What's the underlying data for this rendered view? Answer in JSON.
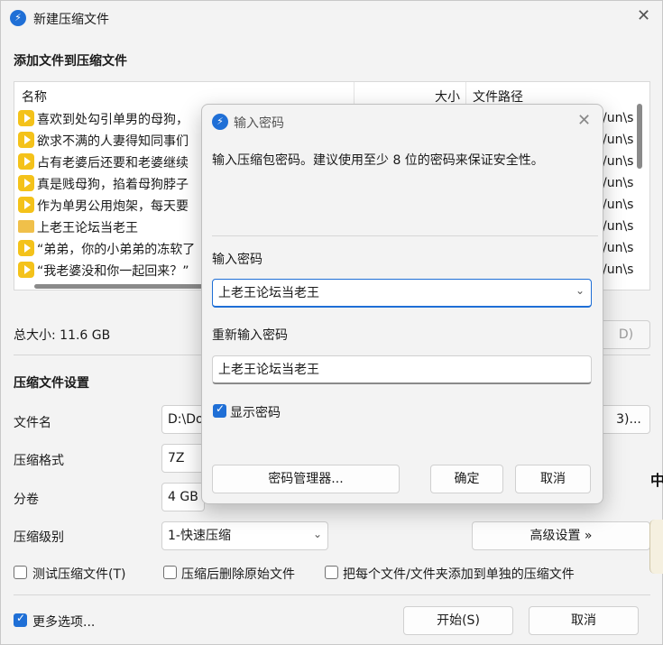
{
  "main": {
    "title": "新建压缩文件",
    "add_files_title": "添加文件到压缩文件",
    "columns": {
      "name": "名称",
      "size": "大小",
      "path": "文件路径"
    },
    "rows": [
      {
        "name": "喜欢到处勾引单男的母狗，",
        "icon": "video-icon",
        "path": "/un\\s"
      },
      {
        "name": "欲求不满的人妻得知同事们",
        "icon": "video-icon",
        "path": "/un\\s"
      },
      {
        "name": "占有老婆后还要和老婆继续",
        "icon": "video-icon",
        "path": "/un\\s"
      },
      {
        "name": "真是贱母狗，掐着母狗脖子",
        "icon": "video-icon",
        "path": "/un\\s"
      },
      {
        "name": "作为单男公用炮架，每天要",
        "icon": "video-icon",
        "path": "/un\\s"
      },
      {
        "name": "上老王论坛当老王",
        "icon": "folder-icon",
        "path": "/un\\s"
      },
      {
        "name": "“弟弟，你的小弟弟的冻软了",
        "icon": "video-icon",
        "path": "/un\\s"
      },
      {
        "name": "“我老婆没和你一起回来？”",
        "icon": "video-icon",
        "path": "/un\\s"
      }
    ],
    "total_size": "总大小: 11.6 GB",
    "hidden_button_fragment": "D)",
    "settings_title": "压缩文件设置",
    "filename_label": "文件名",
    "filename_value": "D:\\Do",
    "browse_fragment": "3)...",
    "format_label": "压缩格式",
    "format_value": "7Z",
    "split_label": "分卷",
    "split_value": "4 GB (",
    "level_label": "压缩级别",
    "level_value": "1-快速压缩",
    "advanced_button": "高级设置 »",
    "test_checkbox": "测试压缩文件(T)",
    "delete_checkbox": "压缩后删除原始文件",
    "separate_checkbox": "把每个文件/文件夹添加到单独的压缩文件",
    "more_options_checkbox": "更多选项...",
    "start_button": "开始(S)",
    "cancel_button": "取消",
    "side_glyph": "中"
  },
  "dialog": {
    "title": "输入密码",
    "instruction": "输入压缩包密码。建议使用至少 8 位的密码来保证安全性。",
    "password_label": "输入密码",
    "password_value": "上老王论坛当老王",
    "reenter_label": "重新输入密码",
    "reenter_value": "上老王论坛当老王",
    "show_password_label": "显示密码",
    "show_password_checked": true,
    "manager_button": "密码管理器...",
    "ok_button": "确定",
    "cancel_button": "取消"
  },
  "colors": {
    "accent": "#1f6fd6",
    "file_icon": "#f4c21a",
    "folder_icon": "#f0c04a"
  }
}
